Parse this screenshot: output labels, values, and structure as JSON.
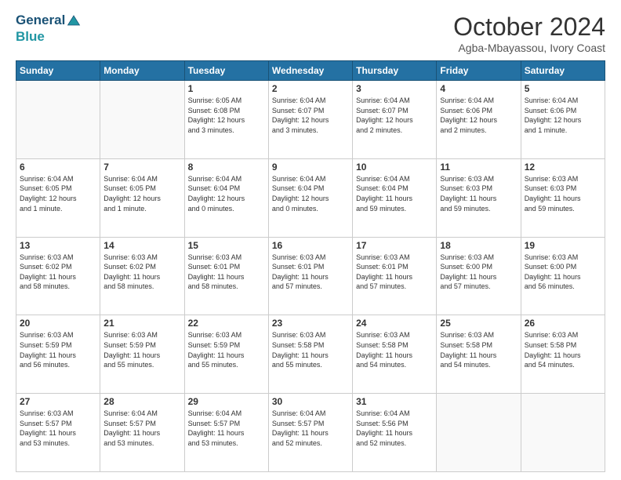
{
  "header": {
    "logo_line1": "General",
    "logo_line2": "Blue",
    "month_title": "October 2024",
    "subtitle": "Agba-Mbayassou, Ivory Coast"
  },
  "calendar": {
    "days_of_week": [
      "Sunday",
      "Monday",
      "Tuesday",
      "Wednesday",
      "Thursday",
      "Friday",
      "Saturday"
    ],
    "weeks": [
      [
        {
          "day": "",
          "info": ""
        },
        {
          "day": "",
          "info": ""
        },
        {
          "day": "1",
          "info": "Sunrise: 6:05 AM\nSunset: 6:08 PM\nDaylight: 12 hours\nand 3 minutes."
        },
        {
          "day": "2",
          "info": "Sunrise: 6:04 AM\nSunset: 6:07 PM\nDaylight: 12 hours\nand 3 minutes."
        },
        {
          "day": "3",
          "info": "Sunrise: 6:04 AM\nSunset: 6:07 PM\nDaylight: 12 hours\nand 2 minutes."
        },
        {
          "day": "4",
          "info": "Sunrise: 6:04 AM\nSunset: 6:06 PM\nDaylight: 12 hours\nand 2 minutes."
        },
        {
          "day": "5",
          "info": "Sunrise: 6:04 AM\nSunset: 6:06 PM\nDaylight: 12 hours\nand 1 minute."
        }
      ],
      [
        {
          "day": "6",
          "info": "Sunrise: 6:04 AM\nSunset: 6:05 PM\nDaylight: 12 hours\nand 1 minute."
        },
        {
          "day": "7",
          "info": "Sunrise: 6:04 AM\nSunset: 6:05 PM\nDaylight: 12 hours\nand 1 minute."
        },
        {
          "day": "8",
          "info": "Sunrise: 6:04 AM\nSunset: 6:04 PM\nDaylight: 12 hours\nand 0 minutes."
        },
        {
          "day": "9",
          "info": "Sunrise: 6:04 AM\nSunset: 6:04 PM\nDaylight: 12 hours\nand 0 minutes."
        },
        {
          "day": "10",
          "info": "Sunrise: 6:04 AM\nSunset: 6:04 PM\nDaylight: 11 hours\nand 59 minutes."
        },
        {
          "day": "11",
          "info": "Sunrise: 6:03 AM\nSunset: 6:03 PM\nDaylight: 11 hours\nand 59 minutes."
        },
        {
          "day": "12",
          "info": "Sunrise: 6:03 AM\nSunset: 6:03 PM\nDaylight: 11 hours\nand 59 minutes."
        }
      ],
      [
        {
          "day": "13",
          "info": "Sunrise: 6:03 AM\nSunset: 6:02 PM\nDaylight: 11 hours\nand 58 minutes."
        },
        {
          "day": "14",
          "info": "Sunrise: 6:03 AM\nSunset: 6:02 PM\nDaylight: 11 hours\nand 58 minutes."
        },
        {
          "day": "15",
          "info": "Sunrise: 6:03 AM\nSunset: 6:01 PM\nDaylight: 11 hours\nand 58 minutes."
        },
        {
          "day": "16",
          "info": "Sunrise: 6:03 AM\nSunset: 6:01 PM\nDaylight: 11 hours\nand 57 minutes."
        },
        {
          "day": "17",
          "info": "Sunrise: 6:03 AM\nSunset: 6:01 PM\nDaylight: 11 hours\nand 57 minutes."
        },
        {
          "day": "18",
          "info": "Sunrise: 6:03 AM\nSunset: 6:00 PM\nDaylight: 11 hours\nand 57 minutes."
        },
        {
          "day": "19",
          "info": "Sunrise: 6:03 AM\nSunset: 6:00 PM\nDaylight: 11 hours\nand 56 minutes."
        }
      ],
      [
        {
          "day": "20",
          "info": "Sunrise: 6:03 AM\nSunset: 5:59 PM\nDaylight: 11 hours\nand 56 minutes."
        },
        {
          "day": "21",
          "info": "Sunrise: 6:03 AM\nSunset: 5:59 PM\nDaylight: 11 hours\nand 55 minutes."
        },
        {
          "day": "22",
          "info": "Sunrise: 6:03 AM\nSunset: 5:59 PM\nDaylight: 11 hours\nand 55 minutes."
        },
        {
          "day": "23",
          "info": "Sunrise: 6:03 AM\nSunset: 5:58 PM\nDaylight: 11 hours\nand 55 minutes."
        },
        {
          "day": "24",
          "info": "Sunrise: 6:03 AM\nSunset: 5:58 PM\nDaylight: 11 hours\nand 54 minutes."
        },
        {
          "day": "25",
          "info": "Sunrise: 6:03 AM\nSunset: 5:58 PM\nDaylight: 11 hours\nand 54 minutes."
        },
        {
          "day": "26",
          "info": "Sunrise: 6:03 AM\nSunset: 5:58 PM\nDaylight: 11 hours\nand 54 minutes."
        }
      ],
      [
        {
          "day": "27",
          "info": "Sunrise: 6:03 AM\nSunset: 5:57 PM\nDaylight: 11 hours\nand 53 minutes."
        },
        {
          "day": "28",
          "info": "Sunrise: 6:04 AM\nSunset: 5:57 PM\nDaylight: 11 hours\nand 53 minutes."
        },
        {
          "day": "29",
          "info": "Sunrise: 6:04 AM\nSunset: 5:57 PM\nDaylight: 11 hours\nand 53 minutes."
        },
        {
          "day": "30",
          "info": "Sunrise: 6:04 AM\nSunset: 5:57 PM\nDaylight: 11 hours\nand 52 minutes."
        },
        {
          "day": "31",
          "info": "Sunrise: 6:04 AM\nSunset: 5:56 PM\nDaylight: 11 hours\nand 52 minutes."
        },
        {
          "day": "",
          "info": ""
        },
        {
          "day": "",
          "info": ""
        }
      ]
    ]
  }
}
